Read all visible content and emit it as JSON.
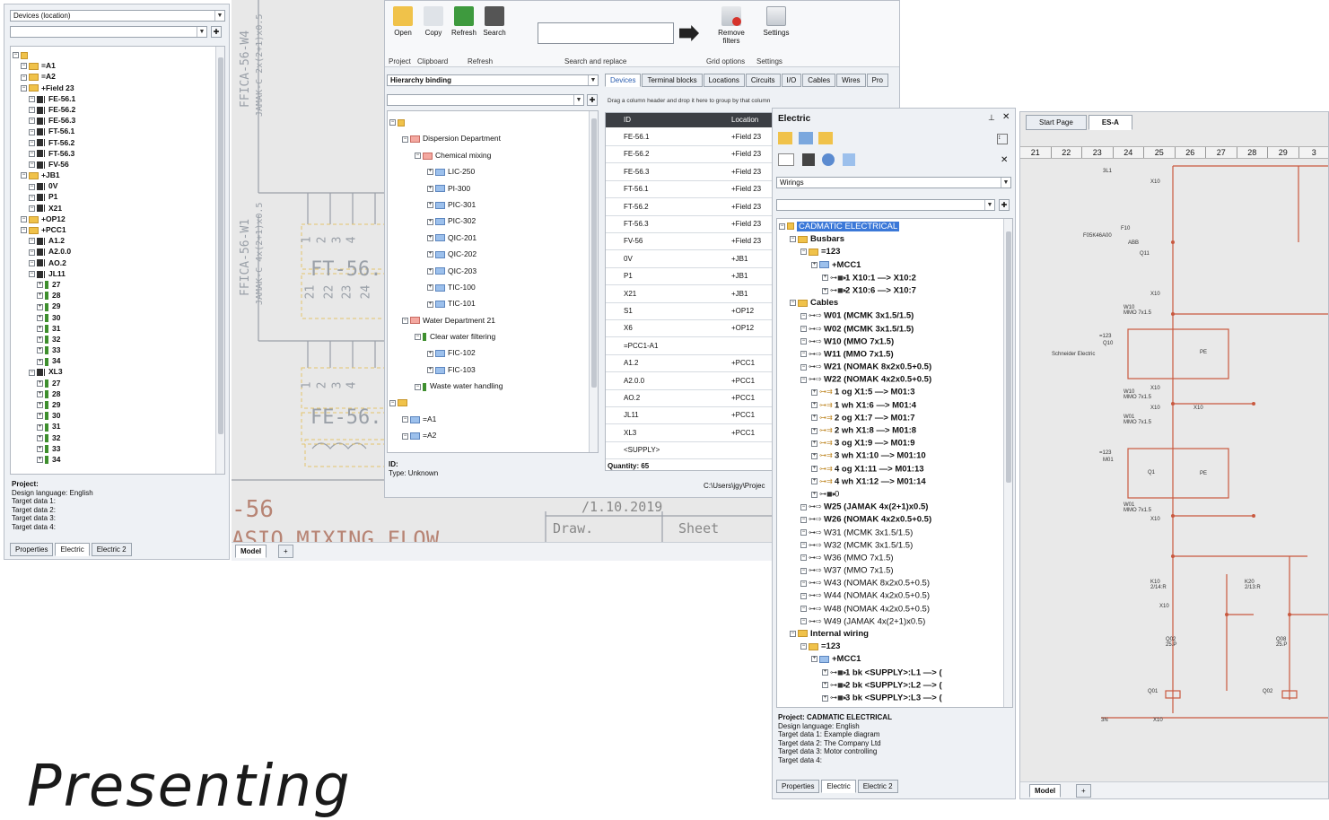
{
  "left_panel": {
    "combo_value": "Devices (location)",
    "tree": [
      {
        "depth": 0,
        "icon": "root",
        "label": ""
      },
      {
        "depth": 1,
        "icon": "folder",
        "label": "=A1"
      },
      {
        "depth": 1,
        "icon": "folder",
        "label": "=A2"
      },
      {
        "depth": 1,
        "icon": "folder-open",
        "label": "+Field 23"
      },
      {
        "depth": 2,
        "icon": "term",
        "label": "FE-56.1"
      },
      {
        "depth": 2,
        "icon": "term",
        "label": "FE-56.2"
      },
      {
        "depth": 2,
        "icon": "term",
        "label": "FE-56.3"
      },
      {
        "depth": 2,
        "icon": "term",
        "label": "FT-56.1"
      },
      {
        "depth": 2,
        "icon": "term",
        "label": "FT-56.2"
      },
      {
        "depth": 2,
        "icon": "term",
        "label": "FT-56.3"
      },
      {
        "depth": 2,
        "icon": "term",
        "label": "FV-56"
      },
      {
        "depth": 1,
        "icon": "folder-open",
        "label": "+JB1"
      },
      {
        "depth": 2,
        "icon": "term",
        "label": "0V"
      },
      {
        "depth": 2,
        "icon": "term",
        "label": "P1"
      },
      {
        "depth": 2,
        "icon": "term",
        "label": "X21"
      },
      {
        "depth": 1,
        "icon": "folder",
        "label": "+OP12"
      },
      {
        "depth": 1,
        "icon": "folder-open",
        "label": "+PCC1"
      },
      {
        "depth": 2,
        "icon": "term",
        "label": "A1.2"
      },
      {
        "depth": 2,
        "icon": "term",
        "label": "A2.0.0"
      },
      {
        "depth": 2,
        "icon": "term",
        "label": "AO.2"
      },
      {
        "depth": 2,
        "icon": "term",
        "label": "JL11"
      },
      {
        "depth": 3,
        "icon": "green",
        "label": "27"
      },
      {
        "depth": 3,
        "icon": "green",
        "label": "28"
      },
      {
        "depth": 3,
        "icon": "green",
        "label": "29"
      },
      {
        "depth": 3,
        "icon": "green",
        "label": "30"
      },
      {
        "depth": 3,
        "icon": "green",
        "label": "31"
      },
      {
        "depth": 3,
        "icon": "green",
        "label": "32"
      },
      {
        "depth": 3,
        "icon": "green",
        "label": "33"
      },
      {
        "depth": 3,
        "icon": "green",
        "label": "34"
      },
      {
        "depth": 2,
        "icon": "term",
        "label": "XL3"
      },
      {
        "depth": 3,
        "icon": "green",
        "label": "27"
      },
      {
        "depth": 3,
        "icon": "green",
        "label": "28"
      },
      {
        "depth": 3,
        "icon": "green",
        "label": "29"
      },
      {
        "depth": 3,
        "icon": "green",
        "label": "30"
      },
      {
        "depth": 3,
        "icon": "green",
        "label": "31"
      },
      {
        "depth": 3,
        "icon": "green",
        "label": "32"
      },
      {
        "depth": 3,
        "icon": "green",
        "label": "33"
      },
      {
        "depth": 3,
        "icon": "green",
        "label": "34"
      }
    ],
    "info": [
      "Project:",
      "Design language: English",
      "Target data 1:",
      "Target data 2:",
      "Target data 3:",
      "Target data 4:"
    ],
    "tabs": [
      "Properties",
      "Electric",
      "Electric 2"
    ],
    "active_tab": "Electric"
  },
  "bg_drawing": {
    "cable1": "FFICA-56-W4",
    "cable1_type": "JAMAK-C 2x(2+1)x0.5",
    "cable2": "FFICA-56-W1",
    "cable2_type": "JAMAK-C 4x(2+1)x0.5",
    "ft_label": "FT-56.",
    "fe_label": "FE-56.",
    "nums1": [
      "1",
      "2",
      "3",
      "4"
    ],
    "nums2": [
      "21",
      "22",
      "23",
      "24"
    ],
    "nums3": [
      "1",
      "2",
      "3",
      "4"
    ],
    "bottom_num": "-56",
    "bottom_text": "ASIO MIXING FLOW",
    "date": "/1.10.2019",
    "draw": "Draw.",
    "sheet": "Sheet",
    "model_tab": "Model",
    "plus": "+"
  },
  "ribbon": {
    "buttons": [
      {
        "label": "Open",
        "icon": "folder-icon"
      },
      {
        "label": "Copy",
        "icon": "copy-icon"
      },
      {
        "label": "Refresh",
        "icon": "refresh-icon"
      },
      {
        "label": "Search",
        "icon": "binoculars-icon"
      }
    ],
    "search_value": "",
    "remove_label": "Remove filters",
    "settings_label": "Settings",
    "groups": [
      "Project",
      "Clipboard",
      "Refresh",
      "Search and replace",
      "Grid options",
      "Settings"
    ]
  },
  "hierarchy": {
    "combo_value": "Hierarchy binding",
    "tree": [
      {
        "depth": 0,
        "icon": "root",
        "label": ""
      },
      {
        "depth": 1,
        "icon": "folder-red",
        "label": "Dispersion Department"
      },
      {
        "depth": 2,
        "icon": "folder-red",
        "label": "Chemical mixing"
      },
      {
        "depth": 3,
        "icon": "blue",
        "label": "LIC-250"
      },
      {
        "depth": 3,
        "icon": "blue",
        "label": "PI-300"
      },
      {
        "depth": 3,
        "icon": "blue",
        "label": "PIC-301"
      },
      {
        "depth": 3,
        "icon": "blue",
        "label": "PIC-302"
      },
      {
        "depth": 3,
        "icon": "blue",
        "label": "QIC-201"
      },
      {
        "depth": 3,
        "icon": "blue",
        "label": "QIC-202"
      },
      {
        "depth": 3,
        "icon": "blue",
        "label": "QIC-203"
      },
      {
        "depth": 3,
        "icon": "blue",
        "label": "TIC-100"
      },
      {
        "depth": 3,
        "icon": "blue",
        "label": "TIC-101"
      },
      {
        "depth": 1,
        "icon": "folder-red",
        "label": "Water Department 21"
      },
      {
        "depth": 2,
        "icon": "green",
        "label": "Clear water filtering"
      },
      {
        "depth": 3,
        "icon": "blue",
        "label": "FIC-102"
      },
      {
        "depth": 3,
        "icon": "blue",
        "label": "FIC-103"
      },
      {
        "depth": 2,
        "icon": "green",
        "label": "Waste water handling"
      },
      {
        "depth": 0,
        "icon": "folder",
        "label": ""
      },
      {
        "depth": 1,
        "icon": "blue",
        "label": "=A1"
      },
      {
        "depth": 1,
        "icon": "blue",
        "label": "=A2"
      }
    ],
    "info": [
      "ID:",
      "Type: Unknown"
    ]
  },
  "grid": {
    "tabs": [
      "Devices",
      "Terminal blocks",
      "Locations",
      "Circuits",
      "I/O",
      "Cables",
      "Wires",
      "Pro"
    ],
    "hint": "Drag a column header and drop it here to group by that column",
    "col_id": "ID",
    "col_loc": "Location",
    "rows": [
      {
        "id": "FE-56.1",
        "loc": "+Field 23"
      },
      {
        "id": "FE-56.2",
        "loc": "+Field 23"
      },
      {
        "id": "FE-56.3",
        "loc": "+Field 23"
      },
      {
        "id": "FT-56.1",
        "loc": "+Field 23"
      },
      {
        "id": "FT-56.2",
        "loc": "+Field 23"
      },
      {
        "id": "FT-56.3",
        "loc": "+Field 23"
      },
      {
        "id": "FV-56",
        "loc": "+Field 23"
      },
      {
        "id": "0V",
        "loc": "+JB1"
      },
      {
        "id": "P1",
        "loc": "+JB1"
      },
      {
        "id": "X21",
        "loc": "+JB1"
      },
      {
        "id": "S1",
        "loc": "+OP12"
      },
      {
        "id": "X6",
        "loc": "+OP12"
      },
      {
        "id": "=PCC1-A1",
        "loc": ""
      },
      {
        "id": "A1.2",
        "loc": "+PCC1"
      },
      {
        "id": "A2.0.0",
        "loc": "+PCC1"
      },
      {
        "id": "AO.2",
        "loc": "+PCC1"
      },
      {
        "id": "JL11",
        "loc": "+PCC1"
      },
      {
        "id": "XL3",
        "loc": "+PCC1"
      },
      {
        "id": "<SUPPLY>",
        "loc": ""
      }
    ],
    "quantity": "Quantity: 65",
    "path": "C:\\Users\\jgy\\Projec"
  },
  "electric": {
    "title": "Electric",
    "combo_value": "Wirings",
    "tree": [
      {
        "depth": 0,
        "icon": "root",
        "label": "CADMATIC ELECTRICAL",
        "bold": false,
        "sel": true
      },
      {
        "depth": 1,
        "icon": "folder-open",
        "label": "Busbars",
        "bold": true
      },
      {
        "depth": 2,
        "icon": "folder-open",
        "label": "=123",
        "bold": true
      },
      {
        "depth": 3,
        "icon": "folder-blue",
        "label": "+MCC1",
        "bold": true
      },
      {
        "depth": 4,
        "icon": "bus",
        "label": "1       X10:1  —>  X10:2",
        "bold": true
      },
      {
        "depth": 4,
        "icon": "bus",
        "label": "2       X10:6  —>  X10:7",
        "bold": true
      },
      {
        "depth": 1,
        "icon": "folder-open",
        "label": "Cables",
        "bold": true
      },
      {
        "depth": 2,
        "icon": "cable",
        "label": "W01  (MCMK 3x1.5/1.5)",
        "bold": true
      },
      {
        "depth": 2,
        "icon": "cable",
        "label": "W02  (MCMK 3x1.5/1.5)",
        "bold": true
      },
      {
        "depth": 2,
        "icon": "cable",
        "label": "W10  (MMO 7x1.5)",
        "bold": true
      },
      {
        "depth": 2,
        "icon": "cable",
        "label": "W11  (MMO 7x1.5)",
        "bold": true
      },
      {
        "depth": 2,
        "icon": "cable",
        "label": "W21  (NOMAK 8x2x0.5+0.5)",
        "bold": true
      },
      {
        "depth": 2,
        "icon": "cable",
        "label": "W22  (NOMAK 4x2x0.5+0.5)",
        "bold": true
      },
      {
        "depth": 3,
        "icon": "wire",
        "label": "1 og    X1:5  —>  M01:3",
        "bold": true
      },
      {
        "depth": 3,
        "icon": "wire",
        "label": "1 wh    X1:6  —>  M01:4",
        "bold": true
      },
      {
        "depth": 3,
        "icon": "wire",
        "label": "2 og    X1:7  —>  M01:7",
        "bold": true
      },
      {
        "depth": 3,
        "icon": "wire",
        "label": "2 wh    X1:8  —>  M01:8",
        "bold": true
      },
      {
        "depth": 3,
        "icon": "wire",
        "label": "3 og    X1:9  —>  M01:9",
        "bold": true
      },
      {
        "depth": 3,
        "icon": "wire",
        "label": "3 wh    X1:10  —>  M01:10",
        "bold": true
      },
      {
        "depth": 3,
        "icon": "wire",
        "label": "4 og    X1:11  —>  M01:13",
        "bold": true
      },
      {
        "depth": 3,
        "icon": "wire",
        "label": "4 wh    X1:12  —>  M01:14",
        "bold": true
      },
      {
        "depth": 3,
        "icon": "bus",
        "label": "0",
        "bold": false
      },
      {
        "depth": 2,
        "icon": "cable",
        "label": "W25  (JAMAK 4x(2+1)x0.5)",
        "bold": true
      },
      {
        "depth": 2,
        "icon": "cable",
        "label": "W26  (NOMAK 4x2x0.5+0.5)",
        "bold": true
      },
      {
        "depth": 2,
        "icon": "cable",
        "label": "W31  (MCMK 3x1.5/1.5)",
        "bold": false
      },
      {
        "depth": 2,
        "icon": "cable",
        "label": "W32  (MCMK 3x1.5/1.5)",
        "bold": false
      },
      {
        "depth": 2,
        "icon": "cable",
        "label": "W36  (MMO 7x1.5)",
        "bold": false
      },
      {
        "depth": 2,
        "icon": "cable",
        "label": "W37  (MMO 7x1.5)",
        "bold": false
      },
      {
        "depth": 2,
        "icon": "cable",
        "label": "W43  (NOMAK 8x2x0.5+0.5)",
        "bold": false
      },
      {
        "depth": 2,
        "icon": "cable",
        "label": "W44  (NOMAK 4x2x0.5+0.5)",
        "bold": false
      },
      {
        "depth": 2,
        "icon": "cable",
        "label": "W48  (NOMAK 4x2x0.5+0.5)",
        "bold": false
      },
      {
        "depth": 2,
        "icon": "cable",
        "label": "W49  (JAMAK 4x(2+1)x0.5)",
        "bold": false
      },
      {
        "depth": 1,
        "icon": "folder-open",
        "label": "Internal wiring",
        "bold": true
      },
      {
        "depth": 2,
        "icon": "folder-open",
        "label": "=123",
        "bold": true
      },
      {
        "depth": 3,
        "icon": "folder-blue",
        "label": "+MCC1",
        "bold": true
      },
      {
        "depth": 4,
        "icon": "bus",
        "label": "1 bk     <SUPPLY>:L1  —>  (",
        "bold": true
      },
      {
        "depth": 4,
        "icon": "bus",
        "label": "2 bk     <SUPPLY>:L2  —>  (",
        "bold": true
      },
      {
        "depth": 4,
        "icon": "bus",
        "label": "3 bk     <SUPPLY>:L3  —>  (",
        "bold": true
      }
    ],
    "info": [
      "Project: CADMATIC ELECTRICAL",
      "Design language: English",
      "Target data 1: Example diagram",
      "Target data 2: The Company Ltd",
      "Target data 3: Motor controlling",
      "Target data 4:"
    ],
    "tabs": [
      "Properties",
      "Electric",
      "Electric 2"
    ],
    "active_tab": "Electric"
  },
  "schematic": {
    "tabs": [
      "Start Page",
      "ES-A"
    ],
    "ruler": [
      "21",
      "22",
      "23",
      "24",
      "25",
      "26",
      "27",
      "28",
      "29",
      "3"
    ],
    "model_tab": "Model",
    "plus": "+",
    "labels": [
      "3L1",
      "X10",
      "F10",
      "F05K46A00",
      "ABB",
      "Q11",
      "X10",
      "W10",
      "MMO 7x1.5",
      "=123",
      "Q10",
      "Schneider Electric",
      "PE",
      "X10",
      "W10",
      "MMO 7x1.5",
      "X10",
      "X10",
      "W01",
      "MMO 7x1.5",
      "=123",
      "M01",
      "Q1",
      "PE",
      "W01",
      "MMO 7x1.5",
      "X10",
      "K10",
      "2/14:R",
      "K20",
      "2/13:R",
      "X10",
      "Q02",
      "25.P",
      "Q08",
      "25.P",
      "Q01",
      "Q02",
      "X10",
      "3N"
    ]
  },
  "headline": "Presenting"
}
